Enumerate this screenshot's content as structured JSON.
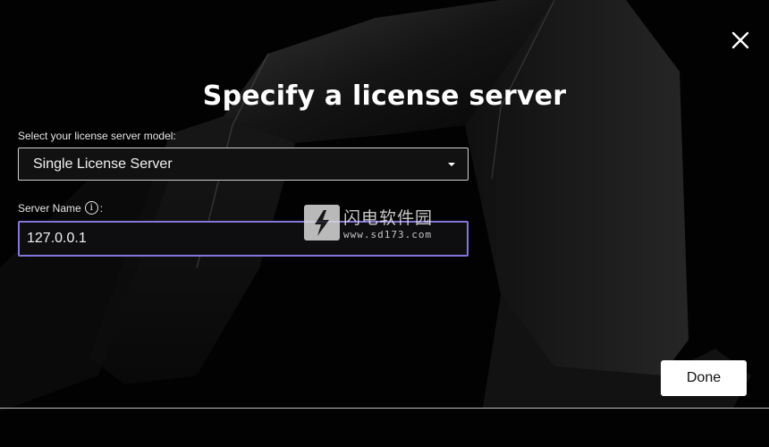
{
  "dialog": {
    "title": "Specify a license server",
    "close_icon": "close-icon"
  },
  "form": {
    "model_label": "Select your license server model:",
    "model_selected": "Single License Server",
    "server_name_label": "Server Name",
    "server_name_info_icon": "info-icon",
    "server_name_info_glyph": "i",
    "server_name_colon": ":",
    "server_name_value": "127.0.0.1"
  },
  "watermark": {
    "text": "闪电软件园",
    "url": "www.sd173.com",
    "logo_icon": "lightning-bolt-icon"
  },
  "footer": {
    "done_label": "Done"
  },
  "colors": {
    "background": "#000000",
    "input_focus_border": "#8276d8",
    "done_button_bg": "#ffffff"
  }
}
